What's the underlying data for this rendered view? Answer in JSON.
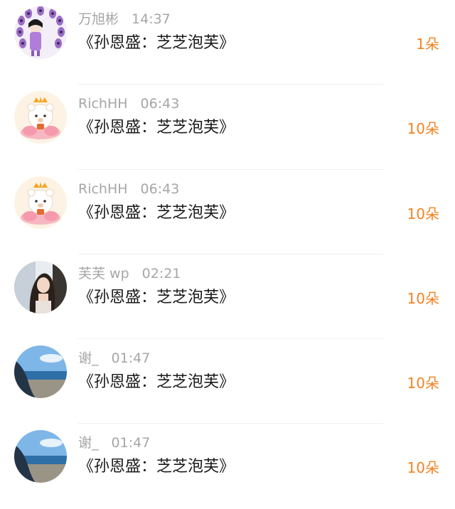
{
  "items": [
    {
      "username": "万旭彬",
      "time": "14:37",
      "title": "《孙恩盛：芝芝泡芙》",
      "count": "1朵",
      "avatar": "peacock-avatar"
    },
    {
      "username": "RichHH",
      "time": "06:43",
      "title": "《孙恩盛：芝芝泡芙》",
      "count": "10朵",
      "avatar": "bear-lotus-avatar"
    },
    {
      "username": "RichHH",
      "time": "06:43",
      "title": "《孙恩盛：芝芝泡芙》",
      "count": "10朵",
      "avatar": "bear-lotus-avatar"
    },
    {
      "username": "芙芙 wp",
      "time": "02:21",
      "title": "《孙恩盛：芝芝泡芙》",
      "count": "10朵",
      "avatar": "girl-photo-avatar"
    },
    {
      "username": "谢_",
      "time": "01:47",
      "title": "《孙恩盛：芝芝泡芙》",
      "count": "10朵",
      "avatar": "beach-photo-avatar"
    },
    {
      "username": "谢_",
      "time": "01:47",
      "title": "《孙恩盛：芝芝泡芙》",
      "count": "10朵",
      "avatar": "beach-photo-avatar"
    }
  ],
  "colors": {
    "count": "#f5821f",
    "meta": "#a6a6a6",
    "title": "#1a1a1a"
  }
}
